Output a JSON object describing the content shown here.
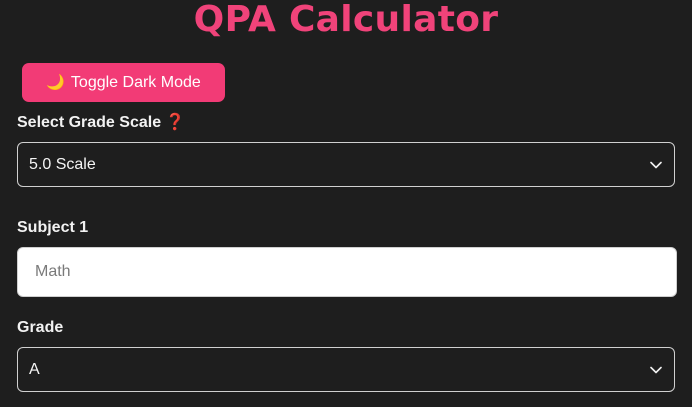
{
  "header": {
    "title": "QPA Calculator"
  },
  "toolbar": {
    "toggle_icon": "🌙",
    "toggle_label": "Toggle Dark Mode"
  },
  "grade_scale": {
    "label": "Select Grade Scale",
    "help_icon": "❓",
    "selected": "5.0 Scale"
  },
  "subject": {
    "label": "Subject 1",
    "placeholder": "Math",
    "value": ""
  },
  "grade": {
    "label": "Grade",
    "selected": "A"
  },
  "colors": {
    "accent": "#f0437a",
    "button": "#f23b76",
    "background": "#1e1e1e"
  }
}
